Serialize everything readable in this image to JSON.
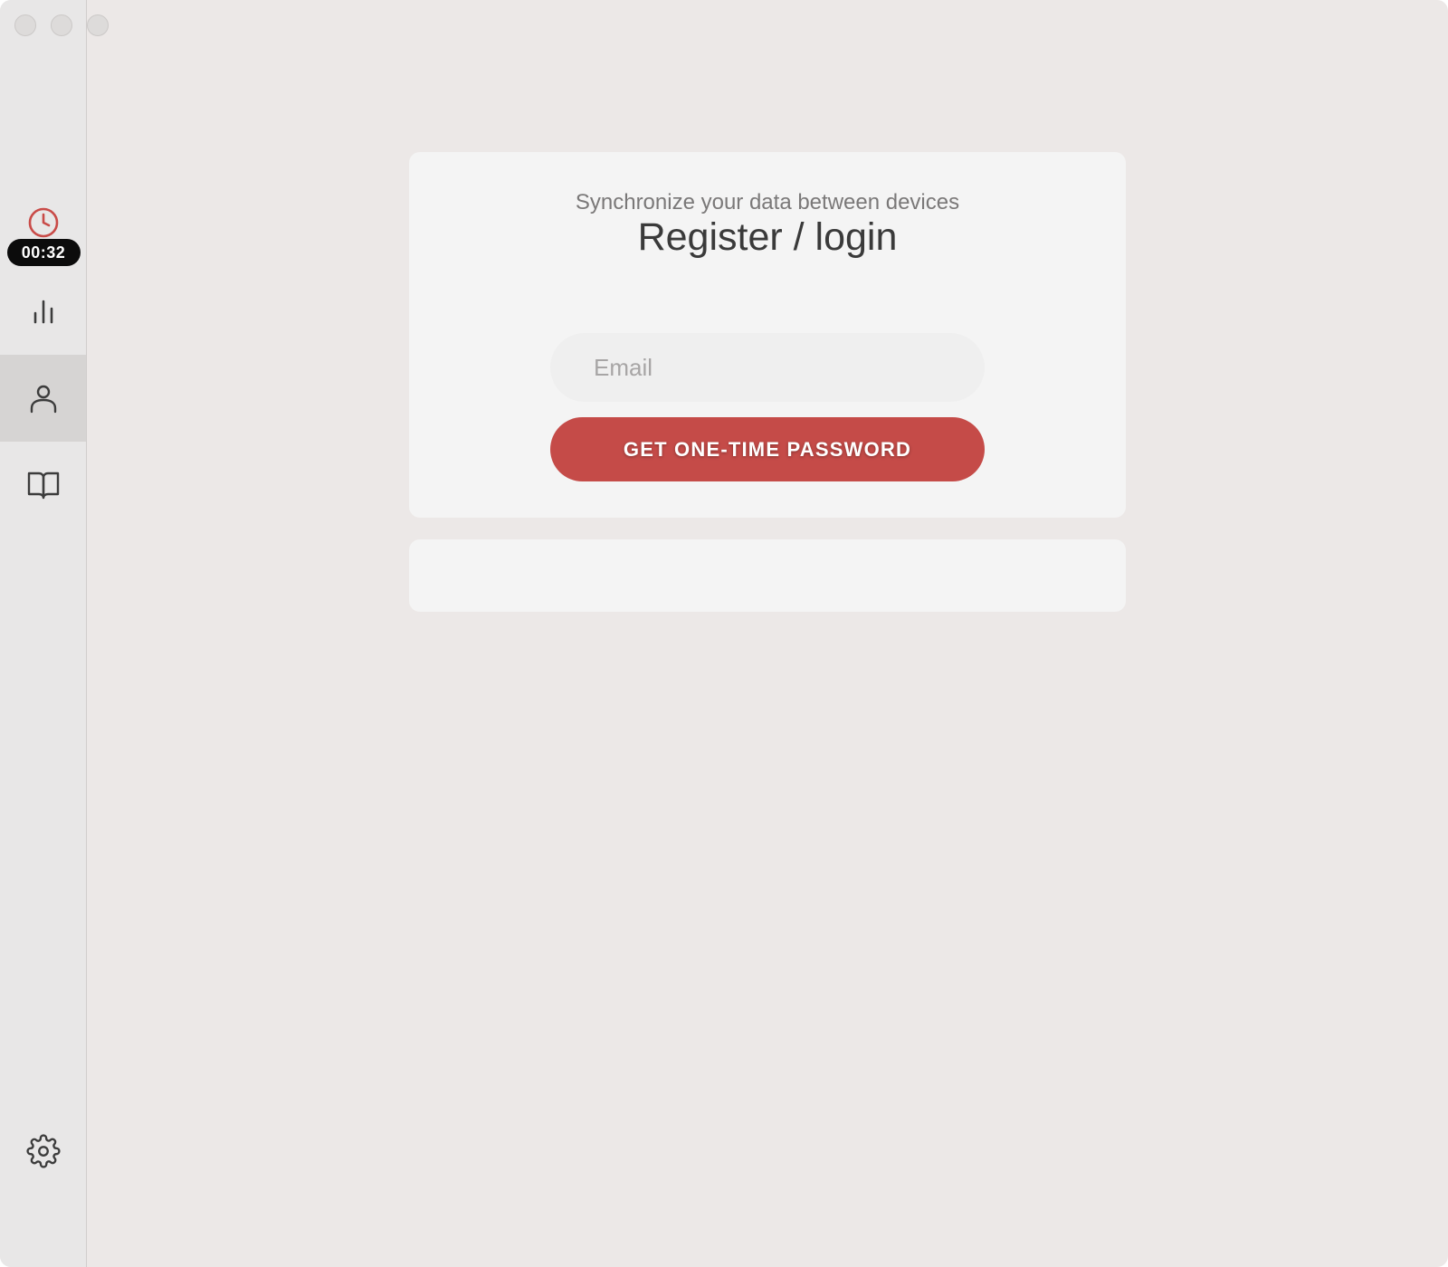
{
  "window": {
    "controls": [
      "close",
      "minimize",
      "zoom"
    ]
  },
  "sidebar": {
    "timer": {
      "icon": "clock-icon",
      "icon_color": "#c94b48",
      "value": "00:32"
    },
    "items": [
      {
        "name": "statistics",
        "icon": "bar-chart-icon",
        "active": false
      },
      {
        "name": "account",
        "icon": "user-icon",
        "active": true
      },
      {
        "name": "documentation",
        "icon": "book-icon",
        "active": false
      }
    ],
    "settings": {
      "icon": "gear-icon"
    }
  },
  "login_card": {
    "subtitle": "Synchronize your data between devices",
    "title": "Register / login",
    "email_placeholder": "Email",
    "email_value": "",
    "button_label": "GET ONE-TIME PASSWORD",
    "accent_color": "#c54b48"
  }
}
